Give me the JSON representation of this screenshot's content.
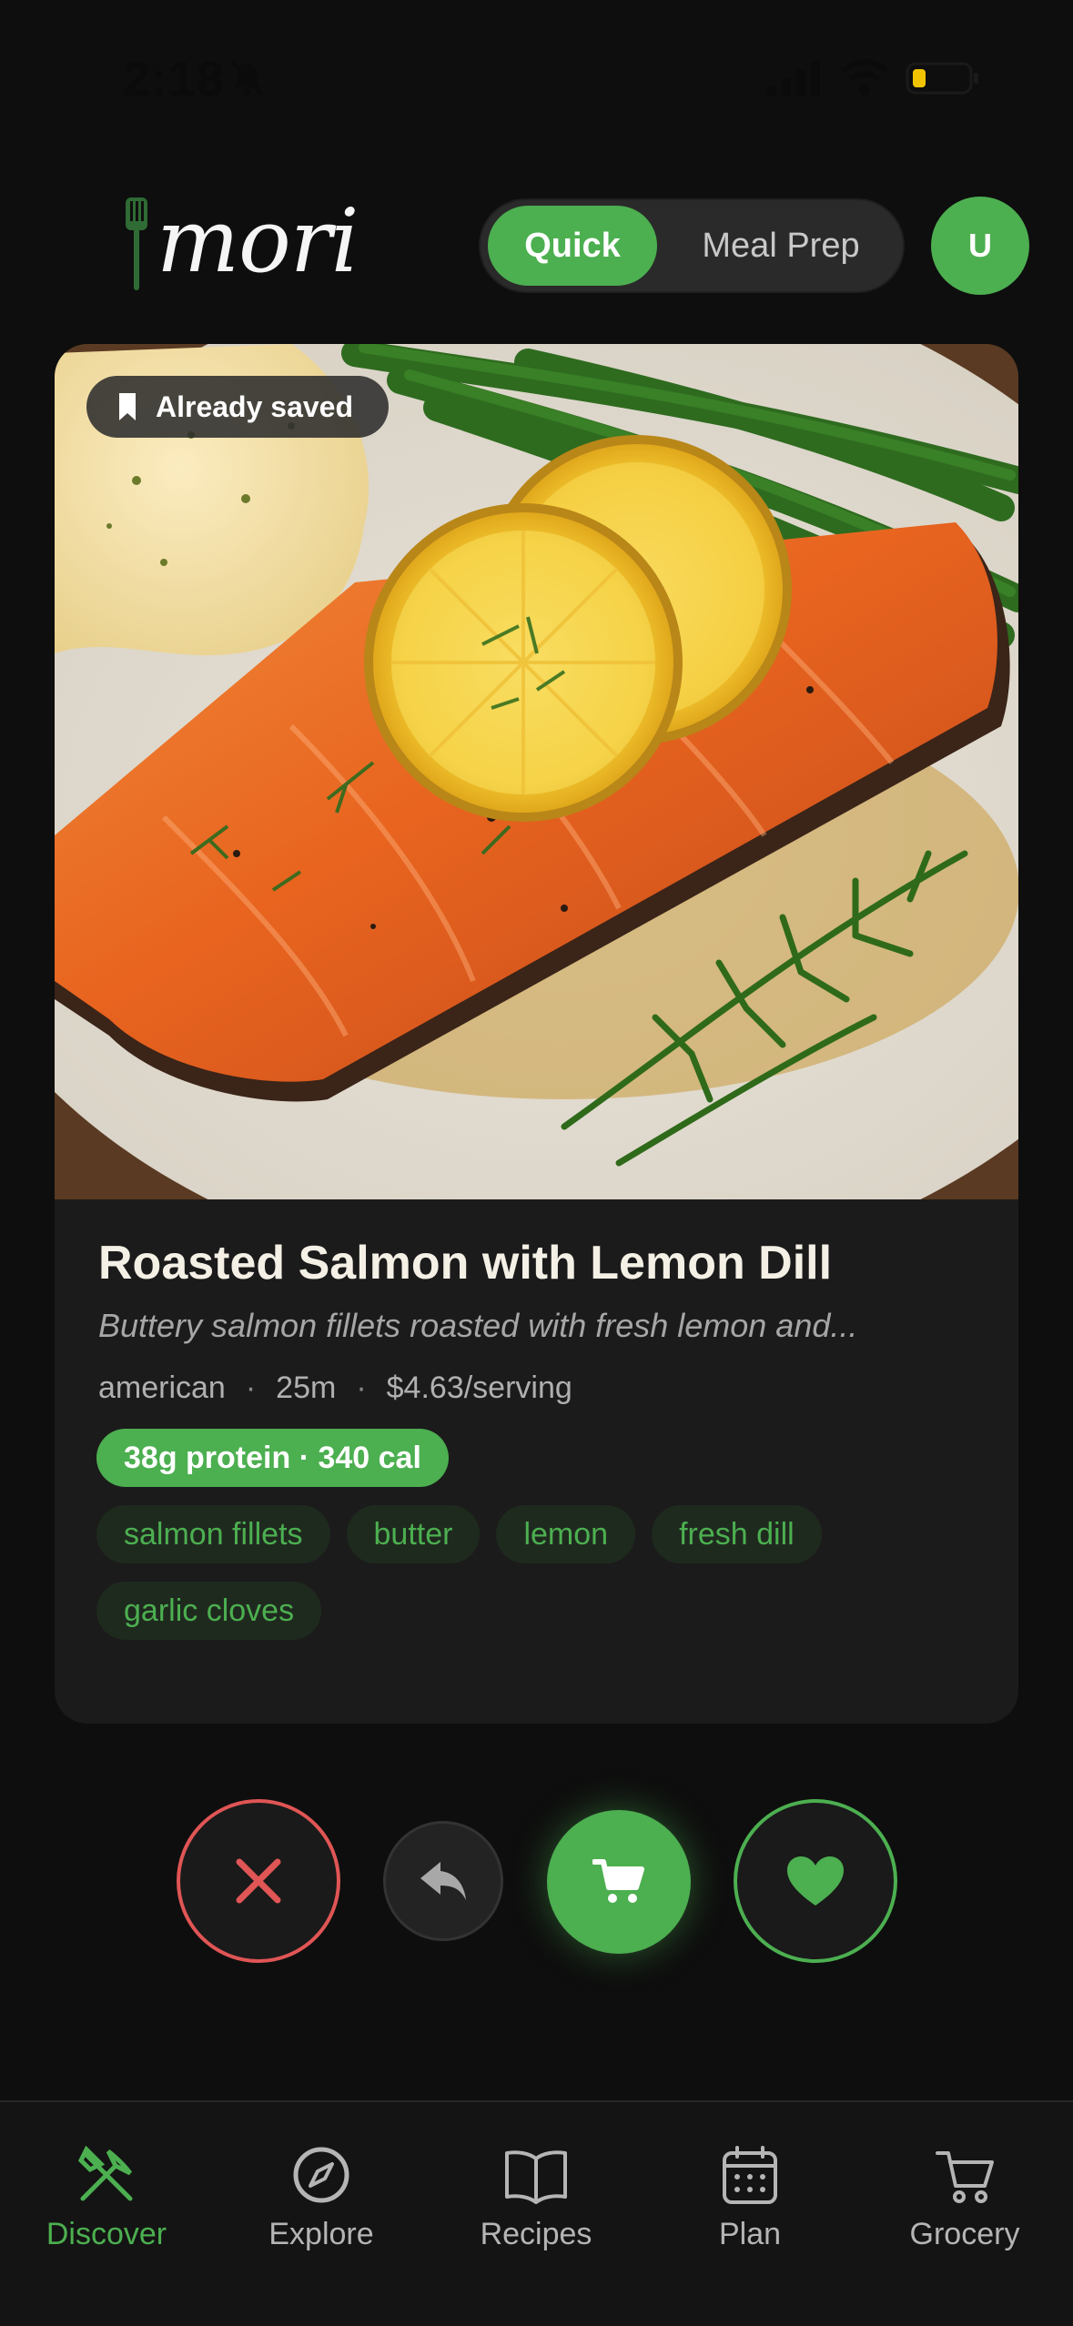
{
  "status_bar": {
    "time": "2:18"
  },
  "header": {
    "logo_text": "mori",
    "modes": [
      "Quick",
      "Meal Prep"
    ],
    "active_mode": "Quick",
    "avatar_initial": "U"
  },
  "recipe": {
    "saved_badge": "Already saved",
    "title": "Roasted Salmon with Lemon Dill",
    "description": "Buttery salmon fillets roasted with fresh lemon and...",
    "cuisine": "american",
    "time": "25m",
    "price": "$4.63/serving",
    "nutrition": "38g protein · 340 cal",
    "ingredients": [
      "salmon fillets",
      "butter",
      "lemon",
      "fresh dill",
      "garlic cloves"
    ]
  },
  "actions": {
    "dislike_icon": "x-icon",
    "undo_icon": "undo-icon",
    "cart_icon": "cart-icon",
    "like_icon": "heart-icon"
  },
  "nav": {
    "items": [
      {
        "label": "Discover",
        "icon": "fork-knife-icon",
        "active": true
      },
      {
        "label": "Explore",
        "icon": "compass-icon",
        "active": false
      },
      {
        "label": "Recipes",
        "icon": "book-icon",
        "active": false
      },
      {
        "label": "Plan",
        "icon": "calendar-icon",
        "active": false
      },
      {
        "label": "Grocery",
        "icon": "cart-icon",
        "active": false
      }
    ]
  },
  "colors": {
    "accent": "#4caf50",
    "danger": "#e05555",
    "background": "#0e0e0e",
    "card": "#1b1b1b"
  }
}
